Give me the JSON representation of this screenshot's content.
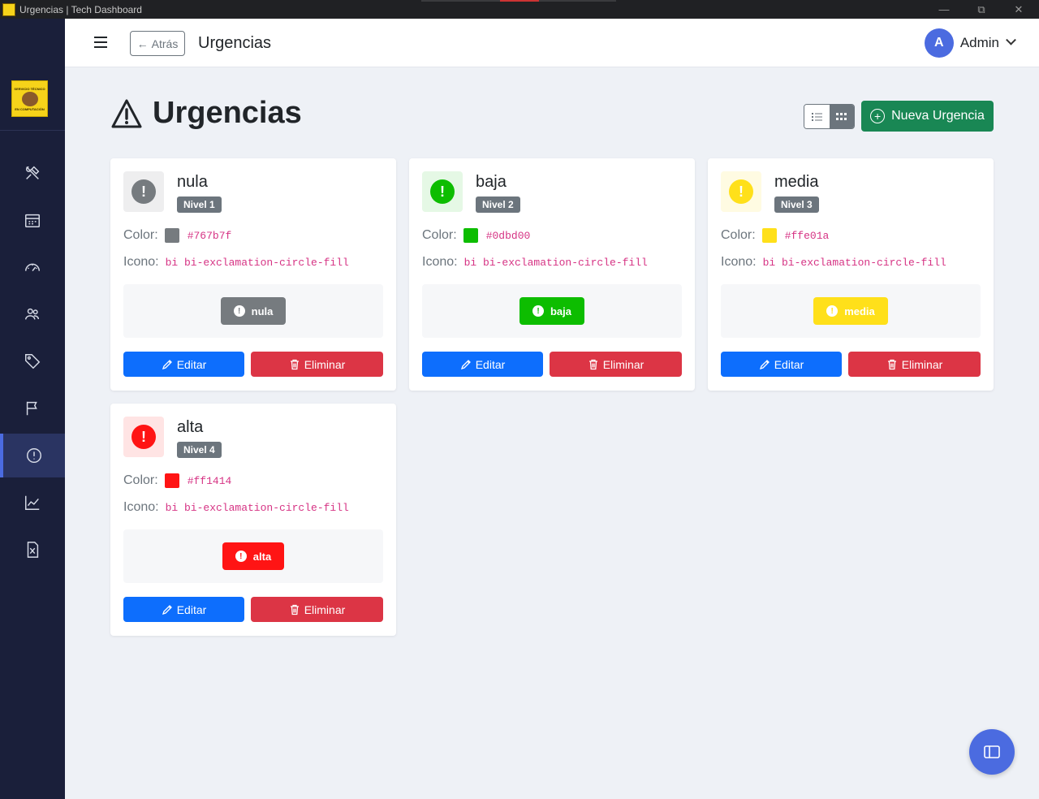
{
  "window": {
    "title": "Urgencias | Tech Dashboard"
  },
  "header": {
    "back_label": "Atrás",
    "title": "Urgencias"
  },
  "user": {
    "initial": "A",
    "name": "Admin"
  },
  "page": {
    "heading": "Urgencias",
    "new_button_label": "Nueva Urgencia"
  },
  "labels": {
    "color": "Color:",
    "icon": "Icono:",
    "edit": "Editar",
    "delete": "Eliminar"
  },
  "sidebar": {
    "logo_text_top": "SERVICIO TÉCNICO",
    "logo_text_bottom": "EN COMPUTACIÓN",
    "items": [
      {
        "icon": "tools-icon"
      },
      {
        "icon": "calendar-icon"
      },
      {
        "icon": "speedometer-icon"
      },
      {
        "icon": "users-icon"
      },
      {
        "icon": "tags-icon"
      },
      {
        "icon": "flag-icon"
      },
      {
        "icon": "exclamation-circle-icon",
        "active": true
      },
      {
        "icon": "graph-icon"
      },
      {
        "icon": "excel-file-icon"
      }
    ]
  },
  "urgencies": [
    {
      "name": "nula",
      "level": "Nivel 1",
      "color": "#767b7f",
      "icon_class": "bi bi-exclamation-circle-fill",
      "box_bg": "#eeeeef",
      "badge_text": "#ffffff"
    },
    {
      "name": "baja",
      "level": "Nivel 2",
      "color": "#0dbd00",
      "icon_class": "bi bi-exclamation-circle-fill",
      "box_bg": "#e5f8e5",
      "badge_text": "#ffffff"
    },
    {
      "name": "media",
      "level": "Nivel 3",
      "color": "#ffe01a",
      "icon_class": "bi bi-exclamation-circle-fill",
      "box_bg": "#fffbe2",
      "badge_text": "#ffffff"
    },
    {
      "name": "alta",
      "level": "Nivel 4",
      "color": "#ff1414",
      "icon_class": "bi bi-exclamation-circle-fill",
      "box_bg": "#ffe4e4",
      "badge_text": "#ffffff"
    }
  ]
}
